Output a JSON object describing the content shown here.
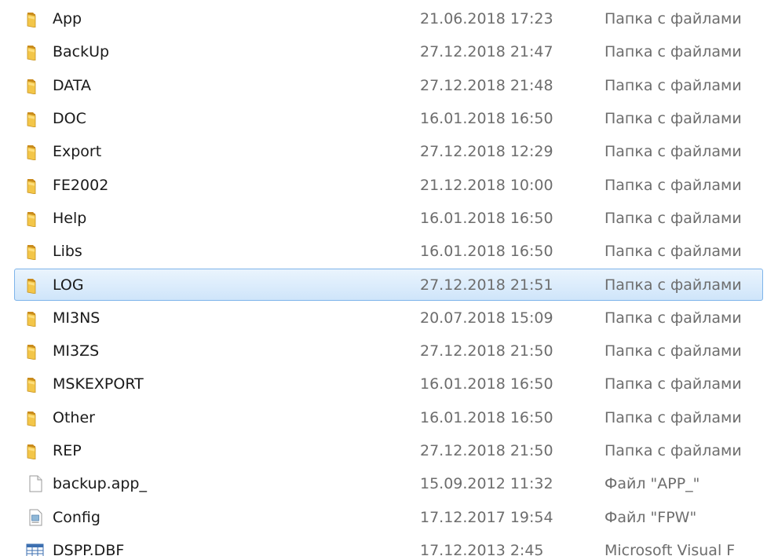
{
  "files": [
    {
      "name": "App",
      "date": "21.06.2018 17:23",
      "type": "Папка с файлами",
      "icon": "folder-icon"
    },
    {
      "name": "BackUp",
      "date": "27.12.2018 21:47",
      "type": "Папка с файлами",
      "icon": "folder-icon"
    },
    {
      "name": "DATA",
      "date": "27.12.2018 21:48",
      "type": "Папка с файлами",
      "icon": "folder-icon"
    },
    {
      "name": "DOC",
      "date": "16.01.2018 16:50",
      "type": "Папка с файлами",
      "icon": "folder-icon"
    },
    {
      "name": "Export",
      "date": "27.12.2018 12:29",
      "type": "Папка с файлами",
      "icon": "folder-icon"
    },
    {
      "name": "FE2002",
      "date": "21.12.2018 10:00",
      "type": "Папка с файлами",
      "icon": "folder-icon"
    },
    {
      "name": "Help",
      "date": "16.01.2018 16:50",
      "type": "Папка с файлами",
      "icon": "folder-icon"
    },
    {
      "name": "Libs",
      "date": "16.01.2018 16:50",
      "type": "Папка с файлами",
      "icon": "folder-icon"
    },
    {
      "name": "LOG",
      "date": "27.12.2018 21:51",
      "type": "Папка с файлами",
      "icon": "folder-icon",
      "selected": true
    },
    {
      "name": "MI3NS",
      "date": "20.07.2018 15:09",
      "type": "Папка с файлами",
      "icon": "folder-icon"
    },
    {
      "name": "MI3ZS",
      "date": "27.12.2018 21:50",
      "type": "Папка с файлами",
      "icon": "folder-icon"
    },
    {
      "name": "MSKEXPORT",
      "date": "16.01.2018 16:50",
      "type": "Папка с файлами",
      "icon": "folder-icon"
    },
    {
      "name": "Other",
      "date": "16.01.2018 16:50",
      "type": "Папка с файлами",
      "icon": "folder-icon"
    },
    {
      "name": "REP",
      "date": "27.12.2018 21:50",
      "type": "Папка с файлами",
      "icon": "folder-icon"
    },
    {
      "name": "backup.app_",
      "date": "15.09.2012 11:32",
      "type": "Файл \"APP_\"",
      "icon": "blank-file-icon"
    },
    {
      "name": "Config",
      "date": "17.12.2017 19:54",
      "type": "Файл \"FPW\"",
      "icon": "config-file-icon"
    },
    {
      "name": "DSPP.DBF",
      "date": "17.12.2013 2:45",
      "type": "Microsoft Visual F",
      "icon": "table-file-icon"
    }
  ],
  "colors": {
    "folder": "#e8b83a",
    "selection_border": "#7eb4ea",
    "selection_fill": "#cfe5fa",
    "secondary_text": "#6d6d6d"
  }
}
